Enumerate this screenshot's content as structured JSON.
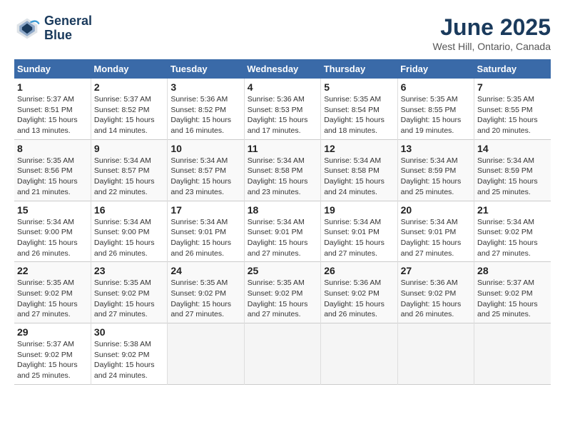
{
  "header": {
    "logo_line1": "General",
    "logo_line2": "Blue",
    "title": "June 2025",
    "subtitle": "West Hill, Ontario, Canada"
  },
  "calendar": {
    "days_of_week": [
      "Sunday",
      "Monday",
      "Tuesday",
      "Wednesday",
      "Thursday",
      "Friday",
      "Saturday"
    ],
    "weeks": [
      [
        null,
        null,
        null,
        null,
        null,
        null,
        null
      ]
    ],
    "cells": [
      {
        "day": 1,
        "col": 0,
        "sunrise": "5:37 AM",
        "sunset": "8:51 PM",
        "daylight": "15 hours and 13 minutes."
      },
      {
        "day": 2,
        "col": 1,
        "sunrise": "5:37 AM",
        "sunset": "8:52 PM",
        "daylight": "15 hours and 14 minutes."
      },
      {
        "day": 3,
        "col": 2,
        "sunrise": "5:36 AM",
        "sunset": "8:52 PM",
        "daylight": "15 hours and 16 minutes."
      },
      {
        "day": 4,
        "col": 3,
        "sunrise": "5:36 AM",
        "sunset": "8:53 PM",
        "daylight": "15 hours and 17 minutes."
      },
      {
        "day": 5,
        "col": 4,
        "sunrise": "5:35 AM",
        "sunset": "8:54 PM",
        "daylight": "15 hours and 18 minutes."
      },
      {
        "day": 6,
        "col": 5,
        "sunrise": "5:35 AM",
        "sunset": "8:55 PM",
        "daylight": "15 hours and 19 minutes."
      },
      {
        "day": 7,
        "col": 6,
        "sunrise": "5:35 AM",
        "sunset": "8:55 PM",
        "daylight": "15 hours and 20 minutes."
      },
      {
        "day": 8,
        "col": 0,
        "sunrise": "5:35 AM",
        "sunset": "8:56 PM",
        "daylight": "15 hours and 21 minutes."
      },
      {
        "day": 9,
        "col": 1,
        "sunrise": "5:34 AM",
        "sunset": "8:57 PM",
        "daylight": "15 hours and 22 minutes."
      },
      {
        "day": 10,
        "col": 2,
        "sunrise": "5:34 AM",
        "sunset": "8:57 PM",
        "daylight": "15 hours and 23 minutes."
      },
      {
        "day": 11,
        "col": 3,
        "sunrise": "5:34 AM",
        "sunset": "8:58 PM",
        "daylight": "15 hours and 23 minutes."
      },
      {
        "day": 12,
        "col": 4,
        "sunrise": "5:34 AM",
        "sunset": "8:58 PM",
        "daylight": "15 hours and 24 minutes."
      },
      {
        "day": 13,
        "col": 5,
        "sunrise": "5:34 AM",
        "sunset": "8:59 PM",
        "daylight": "15 hours and 25 minutes."
      },
      {
        "day": 14,
        "col": 6,
        "sunrise": "5:34 AM",
        "sunset": "8:59 PM",
        "daylight": "15 hours and 25 minutes."
      },
      {
        "day": 15,
        "col": 0,
        "sunrise": "5:34 AM",
        "sunset": "9:00 PM",
        "daylight": "15 hours and 26 minutes."
      },
      {
        "day": 16,
        "col": 1,
        "sunrise": "5:34 AM",
        "sunset": "9:00 PM",
        "daylight": "15 hours and 26 minutes."
      },
      {
        "day": 17,
        "col": 2,
        "sunrise": "5:34 AM",
        "sunset": "9:01 PM",
        "daylight": "15 hours and 26 minutes."
      },
      {
        "day": 18,
        "col": 3,
        "sunrise": "5:34 AM",
        "sunset": "9:01 PM",
        "daylight": "15 hours and 27 minutes."
      },
      {
        "day": 19,
        "col": 4,
        "sunrise": "5:34 AM",
        "sunset": "9:01 PM",
        "daylight": "15 hours and 27 minutes."
      },
      {
        "day": 20,
        "col": 5,
        "sunrise": "5:34 AM",
        "sunset": "9:01 PM",
        "daylight": "15 hours and 27 minutes."
      },
      {
        "day": 21,
        "col": 6,
        "sunrise": "5:34 AM",
        "sunset": "9:02 PM",
        "daylight": "15 hours and 27 minutes."
      },
      {
        "day": 22,
        "col": 0,
        "sunrise": "5:35 AM",
        "sunset": "9:02 PM",
        "daylight": "15 hours and 27 minutes."
      },
      {
        "day": 23,
        "col": 1,
        "sunrise": "5:35 AM",
        "sunset": "9:02 PM",
        "daylight": "15 hours and 27 minutes."
      },
      {
        "day": 24,
        "col": 2,
        "sunrise": "5:35 AM",
        "sunset": "9:02 PM",
        "daylight": "15 hours and 27 minutes."
      },
      {
        "day": 25,
        "col": 3,
        "sunrise": "5:35 AM",
        "sunset": "9:02 PM",
        "daylight": "15 hours and 27 minutes."
      },
      {
        "day": 26,
        "col": 4,
        "sunrise": "5:36 AM",
        "sunset": "9:02 PM",
        "daylight": "15 hours and 26 minutes."
      },
      {
        "day": 27,
        "col": 5,
        "sunrise": "5:36 AM",
        "sunset": "9:02 PM",
        "daylight": "15 hours and 26 minutes."
      },
      {
        "day": 28,
        "col": 6,
        "sunrise": "5:37 AM",
        "sunset": "9:02 PM",
        "daylight": "15 hours and 25 minutes."
      },
      {
        "day": 29,
        "col": 0,
        "sunrise": "5:37 AM",
        "sunset": "9:02 PM",
        "daylight": "15 hours and 25 minutes."
      },
      {
        "day": 30,
        "col": 1,
        "sunrise": "5:38 AM",
        "sunset": "9:02 PM",
        "daylight": "15 hours and 24 minutes."
      }
    ]
  }
}
